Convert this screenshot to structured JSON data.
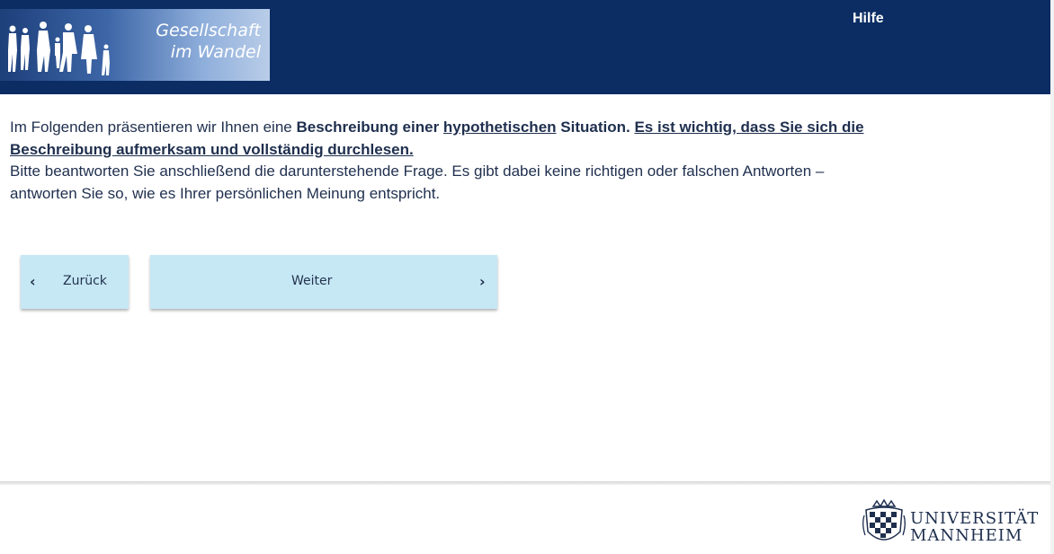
{
  "header": {
    "logo": {
      "line1": "Gesellschaft",
      "line2": "im Wandel"
    },
    "help_label": "Hilfe"
  },
  "intro": {
    "p1_a": "Im Folgenden präsentieren wir Ihnen eine ",
    "p1_b": "Beschreibung einer ",
    "p1_c": "hypothetischen",
    "p1_d": " Situation.",
    "p1_e": "Es ist wichtig, dass Sie sich die Beschreibung aufmerksam und vollständig durchlesen.",
    "p2": "Bitte beantworten Sie anschließend die darunterstehende Frage. Es gibt dabei keine richtigen oder falschen Antworten – antworten Sie so, wie es Ihrer persönlichen Meinung entspricht."
  },
  "nav": {
    "back_label": "Zurück",
    "next_label": "Weiter",
    "back_icon": "chevron-left-icon",
    "next_icon": "chevron-right-icon"
  },
  "footer": {
    "university_line1": "UNIVERSITÄT",
    "university_line2": "MANNHEIM"
  },
  "colors": {
    "header_bg": "#0b2d64",
    "button_bg": "#c6e8f5",
    "text": "#1f2f4e"
  }
}
